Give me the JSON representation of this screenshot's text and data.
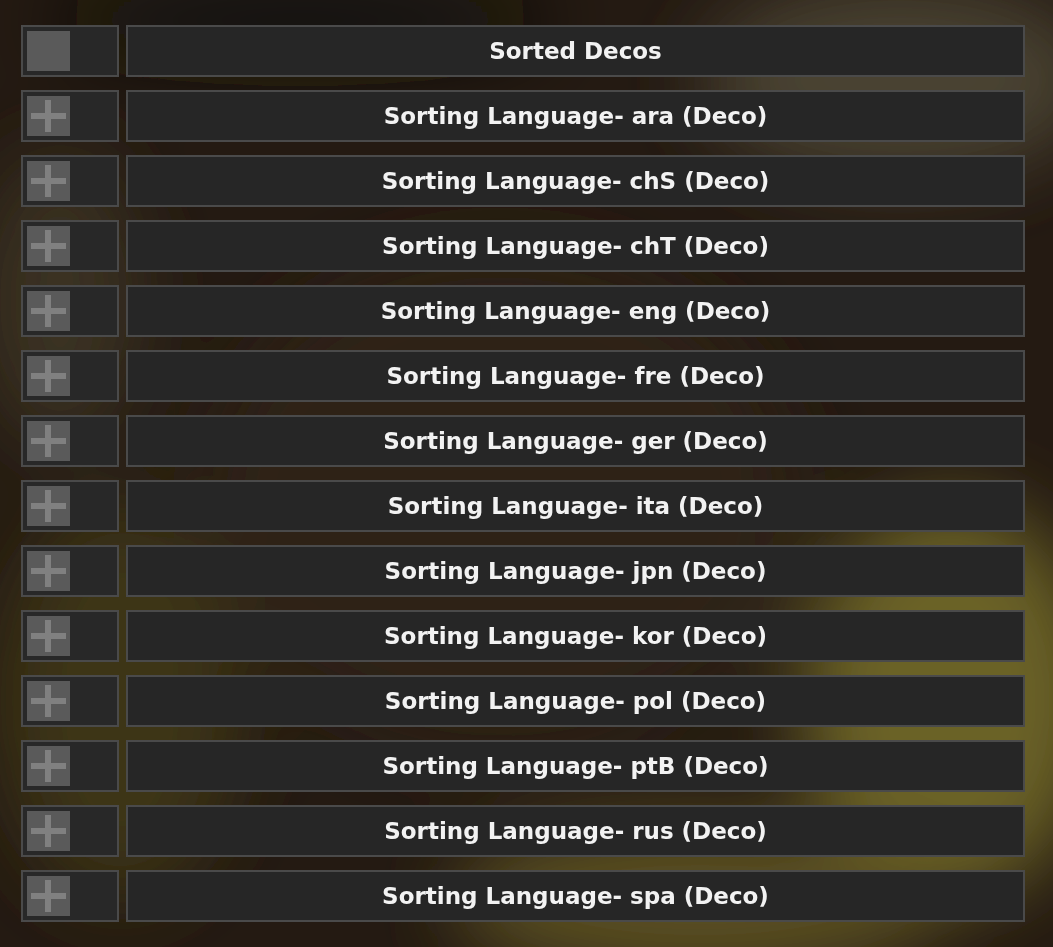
{
  "rows": [
    {
      "kind": "square",
      "label": "Sorted Decos"
    },
    {
      "kind": "plus",
      "label": "Sorting Language- ara (Deco)"
    },
    {
      "kind": "plus",
      "label": "Sorting Language- chS (Deco)"
    },
    {
      "kind": "plus",
      "label": "Sorting Language- chT (Deco)"
    },
    {
      "kind": "plus",
      "label": "Sorting Language- eng (Deco)"
    },
    {
      "kind": "plus",
      "label": "Sorting Language- fre (Deco)"
    },
    {
      "kind": "plus",
      "label": "Sorting Language- ger (Deco)"
    },
    {
      "kind": "plus",
      "label": "Sorting Language- ita (Deco)"
    },
    {
      "kind": "plus",
      "label": "Sorting Language- jpn (Deco)"
    },
    {
      "kind": "plus",
      "label": "Sorting Language- kor (Deco)"
    },
    {
      "kind": "plus",
      "label": "Sorting Language- pol (Deco)"
    },
    {
      "kind": "plus",
      "label": "Sorting Language- ptB (Deco)"
    },
    {
      "kind": "plus",
      "label": "Sorting Language- rus (Deco)"
    },
    {
      "kind": "plus",
      "label": "Sorting Language- spa (Deco)"
    }
  ]
}
